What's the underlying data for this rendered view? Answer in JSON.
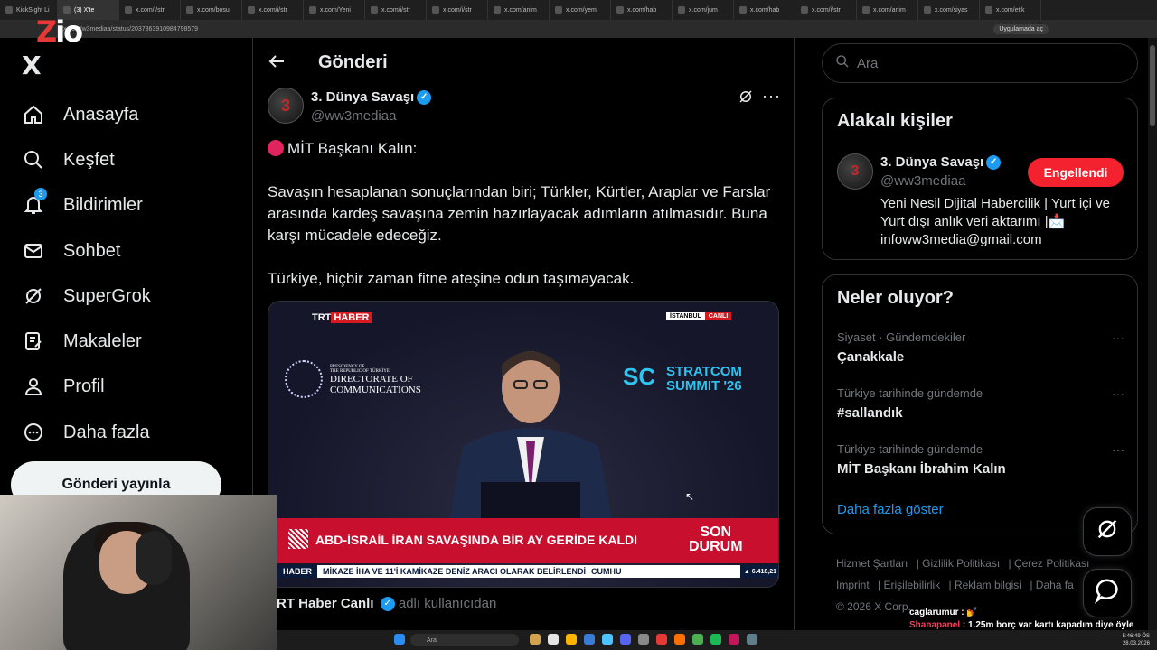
{
  "browser": {
    "tabs": [
      "KickSight Li",
      "(3) X'te",
      "x.com/i/str",
      "x.com/bosu",
      "x.com/i/str",
      "x.com/Yeni",
      "x.com/i/str",
      "x.com/i/str",
      "x.com/anim",
      "x.com/yem",
      "x.com/hab",
      "x.com/jum",
      "x.com/hab",
      "x.com/i/str",
      "x.com/anim",
      "x.com/siyas",
      "x.com/etik"
    ],
    "url": "x.com/w3mediaa/status/2037863910984798579",
    "app_badge": "Uygulamada aç"
  },
  "overlay_logo": {
    "z": "Z",
    "rest": "io"
  },
  "nav": {
    "logo": "X",
    "items": [
      {
        "label": "Anasayfa",
        "icon": "home-icon"
      },
      {
        "label": "Keşfet",
        "icon": "search-icon"
      },
      {
        "label": "Bildirimler",
        "icon": "bell-icon",
        "badge": "3"
      },
      {
        "label": "Sohbet",
        "icon": "mail-icon"
      },
      {
        "label": "SuperGrok",
        "icon": "grok-icon"
      },
      {
        "label": "Makaleler",
        "icon": "article-icon"
      },
      {
        "label": "Profil",
        "icon": "person-icon"
      },
      {
        "label": "Daha fazla",
        "icon": "more-circle-icon"
      }
    ],
    "post_button": "Gönderi yayınla"
  },
  "main": {
    "title": "Gönderi",
    "author": {
      "name": "3. Dünya Savaşı",
      "handle": "@ww3mediaa",
      "avatar_text": "3"
    },
    "post": {
      "heading": "MİT Başkanı Kalın:",
      "paragraph1": "Savaşın hesaplanan sonuçlarından biri; Türkler, Kürtler, Araplar ve Farslar arasında kardeş savaşına zemin hazırlayacak adımların atılmasıdır. Buna karşı mücadele edeceğiz.",
      "paragraph2": "Türkiye, hiçbir zaman fitne ateşine odun taşımayacak."
    },
    "media": {
      "channel_logo_trt": "TRT",
      "channel_logo_haber": "HABER",
      "city": "İSTANBUL",
      "live": "CANLI",
      "dc_small1": "PRESIDENCY OF",
      "dc_small2": "THE REPUBLIC OF TÜRKİYE",
      "dc_line1": "DIRECTORATE OF",
      "dc_line2": "COMMUNICATIONS",
      "sc_mark": "SC",
      "sc_line1": "STRATCOM",
      "sc_line2": "SUMMIT '26",
      "headline": "ABD-İSRAİL İRAN SAVAŞINDA BİR AY GERİDE KALDI",
      "son": "SON",
      "durum": "DURUM",
      "ticker_tag": "HABER",
      "ticker_text": "MİKAZE İHA VE 11'İ KAMİKAZE DENİZ ARACI OLARAK BELİRLENDİ",
      "ticker_tail": "CUMHU",
      "stock": "▲ 6.418,21"
    },
    "quote": {
      "name": "RT Haber Canlı",
      "suffix": "adlı kullanıcıdan"
    }
  },
  "right": {
    "search_placeholder": "Ara",
    "relevant": {
      "title": "Alakalı kişiler",
      "name": "3. Dünya Savaşı",
      "handle": "@ww3mediaa",
      "bio": "Yeni Nesil Dijital Habercilik | Yurt içi ve Yurt dışı anlık veri aktarımı |📩 infoww3media@gmail.com",
      "avatar_text": "3",
      "button": "Engellendi"
    },
    "trending": {
      "title": "Neler oluyor?",
      "items": [
        {
          "meta": "Siyaset · Gündemdekiler",
          "topic": "Çanakkale"
        },
        {
          "meta": "Türkiye tarihinde gündemde",
          "topic": "#sallandık"
        },
        {
          "meta": "Türkiye tarihinde gündemde",
          "topic": "MİT Başkanı İbrahim Kalın"
        }
      ],
      "show_more": "Daha fazla göster"
    },
    "footer": {
      "links": [
        "Hizmet Şartları",
        "Gizlilik Politikası",
        "Çerez Politikası",
        "Imprint",
        "Erişilebilirlik",
        "Reklam bilgisi",
        "Daha fa"
      ],
      "copyright": "© 2026 X Corp."
    }
  },
  "chat": {
    "line1_user": "caglarumur",
    "line1_text": ": 💅",
    "line2_user": "Shanapanel",
    "line2_text": ": 1.25m borç var kartı kapadım diye öyle mesaj geldi"
  },
  "taskbar": {
    "search": "Ara",
    "time": "5:46:49 ÖS",
    "date": "28.03.2026"
  },
  "colors": {
    "accent": "#1d9bf0",
    "block": "#f4212e",
    "breaking": "#c8102e"
  }
}
